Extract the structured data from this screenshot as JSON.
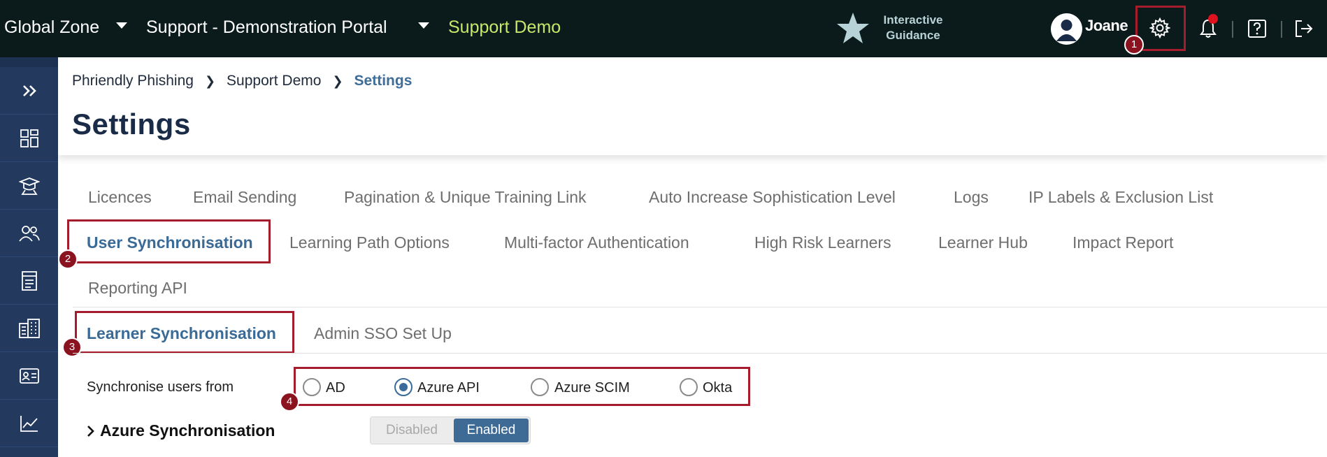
{
  "topbar": {
    "zone": "Global Zone",
    "portal": "Support - Demonstration Portal",
    "org": "Support Demo",
    "guidance_line1": "Interactive",
    "guidance_line2": "Guidance",
    "user_name": "Joane"
  },
  "annotations": [
    "1",
    "2",
    "3",
    "4"
  ],
  "sidebar": {
    "items": [
      "expand-icon",
      "dashboard-icon",
      "training-icon",
      "users-icon",
      "content-icon",
      "organisation-icon",
      "contacts-icon",
      "reports-icon"
    ]
  },
  "breadcrumb": [
    "Phriendly Phishing",
    "Support Demo",
    "Settings"
  ],
  "page_title": "Settings",
  "tabs_row1": [
    "Licences",
    "Email Sending",
    "Pagination & Unique Training Link",
    "Auto Increase Sophistication Level",
    "Logs",
    "IP Labels & Exclusion List"
  ],
  "tabs_row2": [
    "User Synchronisation",
    "Learning Path Options",
    "Multi-factor Authentication",
    "High Risk Learners",
    "Learner Hub",
    "Impact Report"
  ],
  "tabs_row3": [
    "Reporting API"
  ],
  "subtabs": [
    "Learner Synchronisation",
    "Admin SSO Set Up"
  ],
  "sync": {
    "label": "Synchronise users from",
    "options": [
      "AD",
      "Azure API",
      "Azure SCIM",
      "Okta"
    ],
    "selected": "Azure API"
  },
  "azure": {
    "title": "Azure Synchronisation",
    "toggle_off": "Disabled",
    "toggle_on": "Enabled",
    "enabled": true
  },
  "colors": {
    "topbar_bg": "#0b1a1a",
    "sidebar_bg": "#233a5e",
    "accent": "#3a6a96",
    "highlight": "#a51c2c",
    "org_green": "#c9e86a"
  }
}
